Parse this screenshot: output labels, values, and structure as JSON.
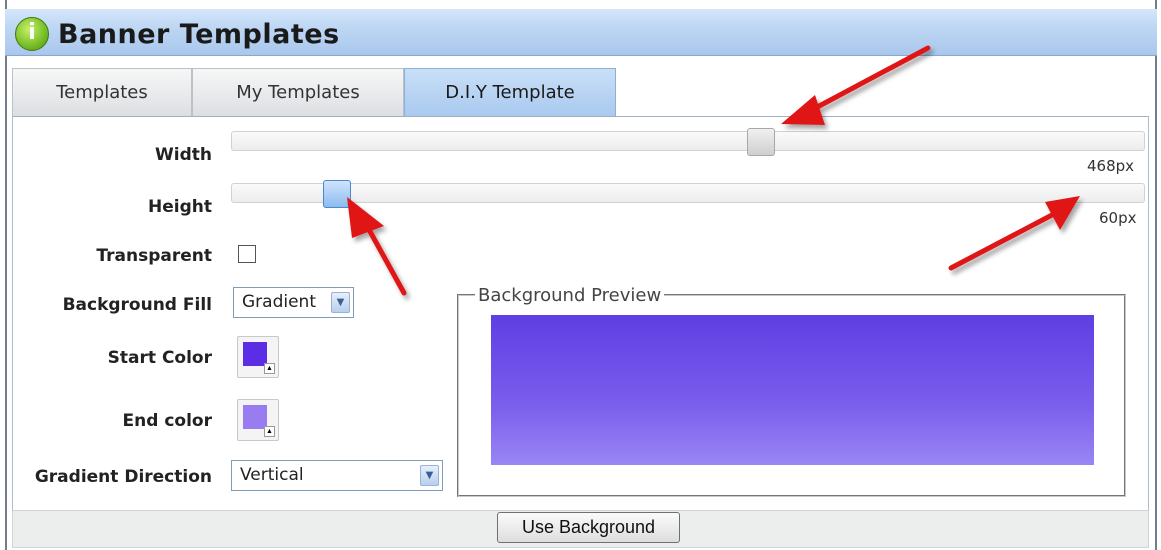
{
  "window": {
    "title": "Banner Templates",
    "icon": "app-info-icon"
  },
  "tabs": [
    {
      "label": "Templates",
      "active": false
    },
    {
      "label": "My Templates",
      "active": false
    },
    {
      "label": "D.I.Y Template",
      "active": true
    }
  ],
  "form": {
    "width": {
      "label": "Width",
      "value": "468px"
    },
    "height": {
      "label": "Height",
      "value": "60px"
    },
    "transparent": {
      "label": "Transparent",
      "checked": false
    },
    "background_fill": {
      "label": "Background Fill",
      "selected": "Gradient"
    },
    "start_color": {
      "label": "Start Color",
      "color": "#5b2ee6"
    },
    "end_color": {
      "label": "End color",
      "color": "#9a7cf1"
    },
    "gradient_direction": {
      "label": "Gradient Direction",
      "selected": "Vertical"
    }
  },
  "preview": {
    "legend": "Background Preview",
    "color_top": "#5f3ee3",
    "color_bottom": "#9a86f4"
  },
  "footer": {
    "use_background_label": "Use Background"
  },
  "annotations": {
    "arrow_color": "#e01818",
    "count": 3
  }
}
